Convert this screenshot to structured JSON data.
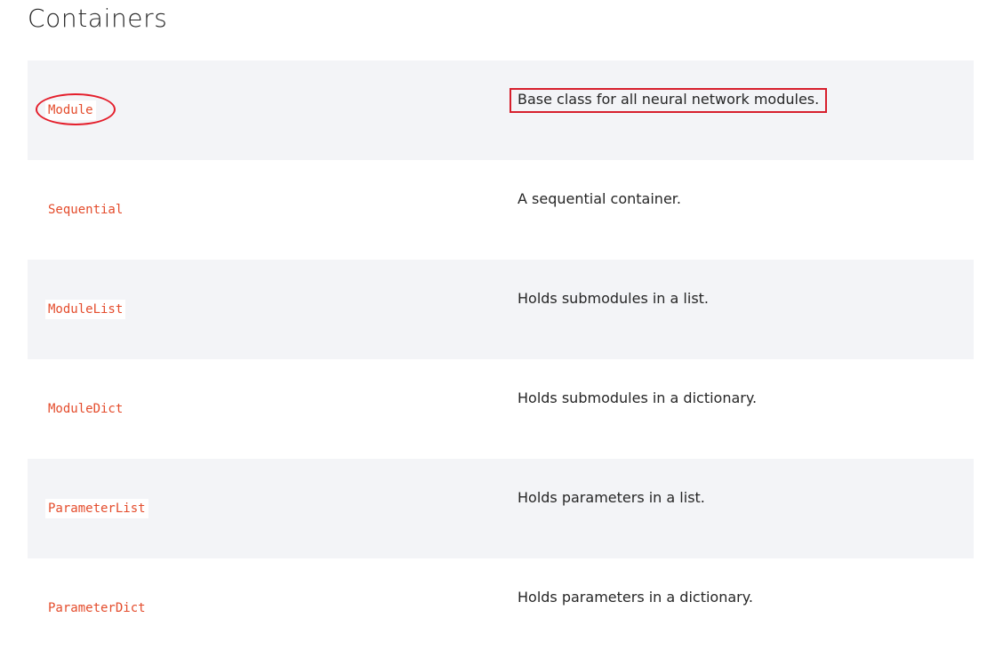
{
  "page": {
    "title": "Containers"
  },
  "table": {
    "rows": [
      {
        "name": "Module",
        "description": "Base class for all neural network modules."
      },
      {
        "name": "Sequential",
        "description": "A sequential container."
      },
      {
        "name": "ModuleList",
        "description": "Holds submodules in a list."
      },
      {
        "name": "ModuleDict",
        "description": "Holds submodules in a dictionary."
      },
      {
        "name": "ParameterList",
        "description": "Holds parameters in a list."
      },
      {
        "name": "ParameterDict",
        "description": "Holds parameters in a dictionary."
      }
    ]
  },
  "colors": {
    "code_text": "#e44c2c",
    "row_alt_bg": "#f3f4f7",
    "annotation": "#e41e2b"
  }
}
